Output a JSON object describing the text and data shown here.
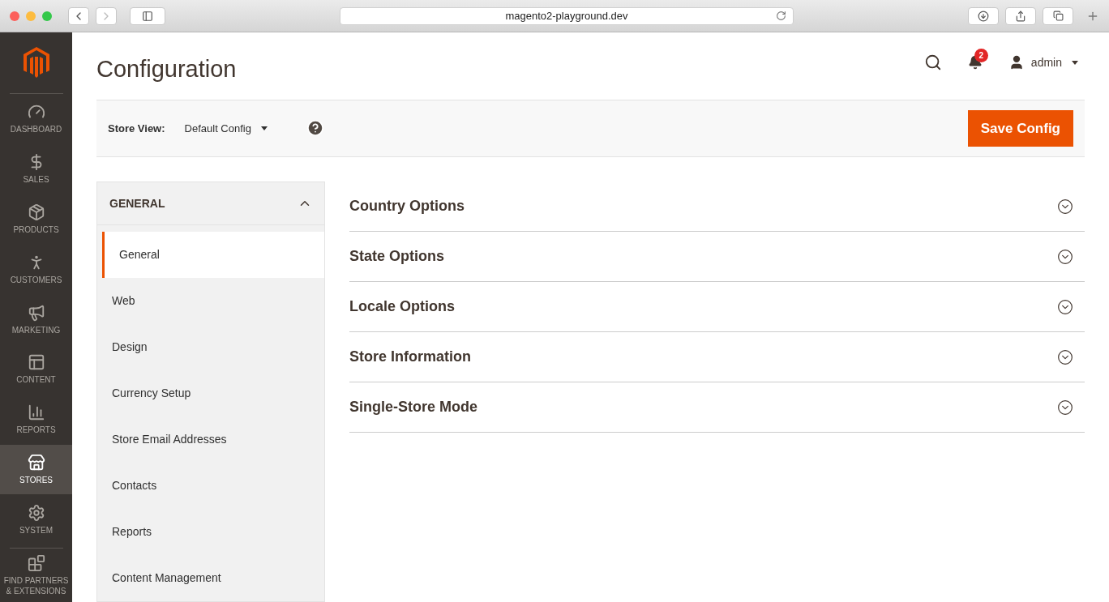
{
  "browser": {
    "url": "magento2-playground.dev"
  },
  "sidebar": {
    "items": [
      {
        "label": "DASHBOARD",
        "selected": false
      },
      {
        "label": "SALES",
        "selected": false
      },
      {
        "label": "PRODUCTS",
        "selected": false
      },
      {
        "label": "CUSTOMERS",
        "selected": false
      },
      {
        "label": "MARKETING",
        "selected": false
      },
      {
        "label": "CONTENT",
        "selected": false
      },
      {
        "label": "REPORTS",
        "selected": false
      },
      {
        "label": "STORES",
        "selected": true
      },
      {
        "label": "SYSTEM",
        "selected": false
      },
      {
        "label": "FIND PARTNERS & EXTENSIONS",
        "selected": false
      }
    ]
  },
  "header": {
    "title": "Configuration",
    "notifications": "2",
    "user": "admin"
  },
  "scope": {
    "label": "Store View:",
    "value": "Default Config"
  },
  "save_button": "Save Config",
  "config_nav": {
    "title": "GENERAL",
    "expanded": true,
    "items": [
      {
        "label": "General",
        "selected": true
      },
      {
        "label": "Web",
        "selected": false
      },
      {
        "label": "Design",
        "selected": false
      },
      {
        "label": "Currency Setup",
        "selected": false
      },
      {
        "label": "Store Email Addresses",
        "selected": false
      },
      {
        "label": "Contacts",
        "selected": false
      },
      {
        "label": "Reports",
        "selected": false
      },
      {
        "label": "Content Management",
        "selected": false
      }
    ]
  },
  "groups": [
    {
      "title": "Country Options",
      "expanded": false
    },
    {
      "title": "State Options",
      "expanded": false
    },
    {
      "title": "Locale Options",
      "expanded": false
    },
    {
      "title": "Store Information",
      "expanded": false
    },
    {
      "title": "Single-Store Mode",
      "expanded": false
    }
  ]
}
